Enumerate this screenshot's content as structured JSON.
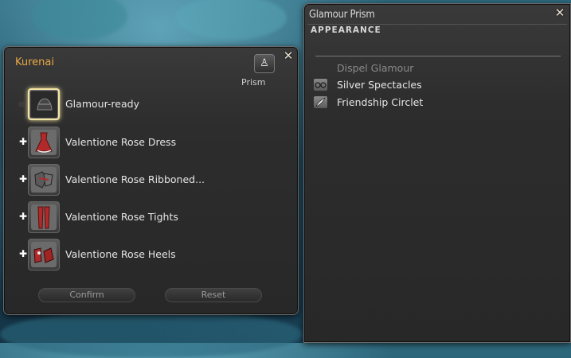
{
  "kurenai": {
    "title": "Kurenai",
    "prism_label": "Prism",
    "slots": [
      {
        "label": "Glamour-ready",
        "icon": "glamour-ready-headgear-icon",
        "plus": false
      },
      {
        "label": "Valentione Rose Dress",
        "icon": "rose-dress-icon",
        "plus": true
      },
      {
        "label": "Valentione Rose Ribboned...",
        "icon": "rose-gloves-icon",
        "plus": true
      },
      {
        "label": "Valentione Rose Tights",
        "icon": "rose-tights-icon",
        "plus": true
      },
      {
        "label": "Valentione Rose Heels",
        "icon": "rose-heels-icon",
        "plus": true
      }
    ],
    "confirm_label": "Confirm",
    "reset_label": "Reset"
  },
  "prism": {
    "title": "Glamour Prism",
    "subtitle": "APPEARANCE",
    "dispel_label": "Dispel Glamour",
    "items": [
      {
        "label": "Silver Spectacles",
        "icon": "spectacles-icon"
      },
      {
        "label": "Friendship Circlet",
        "icon": "feather-circlet-icon"
      }
    ]
  },
  "colors": {
    "title_orange": "#e8a845",
    "ready_glow": "#f2e4a4",
    "item_red": "#b02a2a"
  }
}
